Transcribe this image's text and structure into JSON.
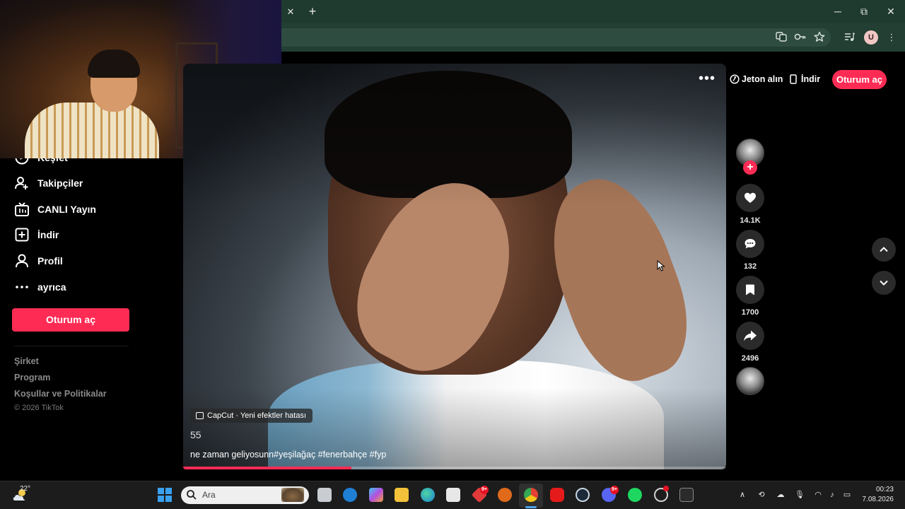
{
  "browser": {
    "tab_close": "✕",
    "new_tab": "+",
    "profile_initial": "U"
  },
  "sidebar": {
    "items": [
      {
        "label": "Keşfet",
        "icon": "compass-icon"
      },
      {
        "label": "Takipçiler",
        "icon": "followers-icon"
      },
      {
        "label": "CANLI Yayın",
        "icon": "live-tv-icon"
      },
      {
        "label": "İndir",
        "icon": "download-plus-icon"
      },
      {
        "label": "Profil",
        "icon": "profile-icon"
      },
      {
        "label": "ayrıca",
        "icon": "more-dots-icon"
      }
    ],
    "login_button": "Oturum aç",
    "footer_links": [
      "Şirket",
      "Program",
      "Koşullar ve Politikalar"
    ],
    "copyright": "© 2026 TikTok"
  },
  "header": {
    "coins": "Jeton alın",
    "download": "İndir",
    "login": "Oturum aç"
  },
  "video": {
    "effect_badge": "CapCut · Yeni efektler hatası",
    "number": "55",
    "caption": "ne zaman geliyosunn#yeşilağaç #fenerbahçe #fyp",
    "progress": 0.31
  },
  "actions": {
    "likes": "14.1K",
    "comments": "132",
    "saves": "1700",
    "shares": "2496",
    "follow": "+"
  },
  "taskbar": {
    "weather_temp": "22°",
    "search_placeholder": "Ara",
    "badge_notifications": "9+",
    "badge_discord": "9+",
    "time": "00:23",
    "date": "7.08.2026"
  },
  "colors": {
    "brand": "#fe2c55",
    "chrome_green": "#1f3a2f",
    "windows_blue": "#3aa0f0"
  }
}
